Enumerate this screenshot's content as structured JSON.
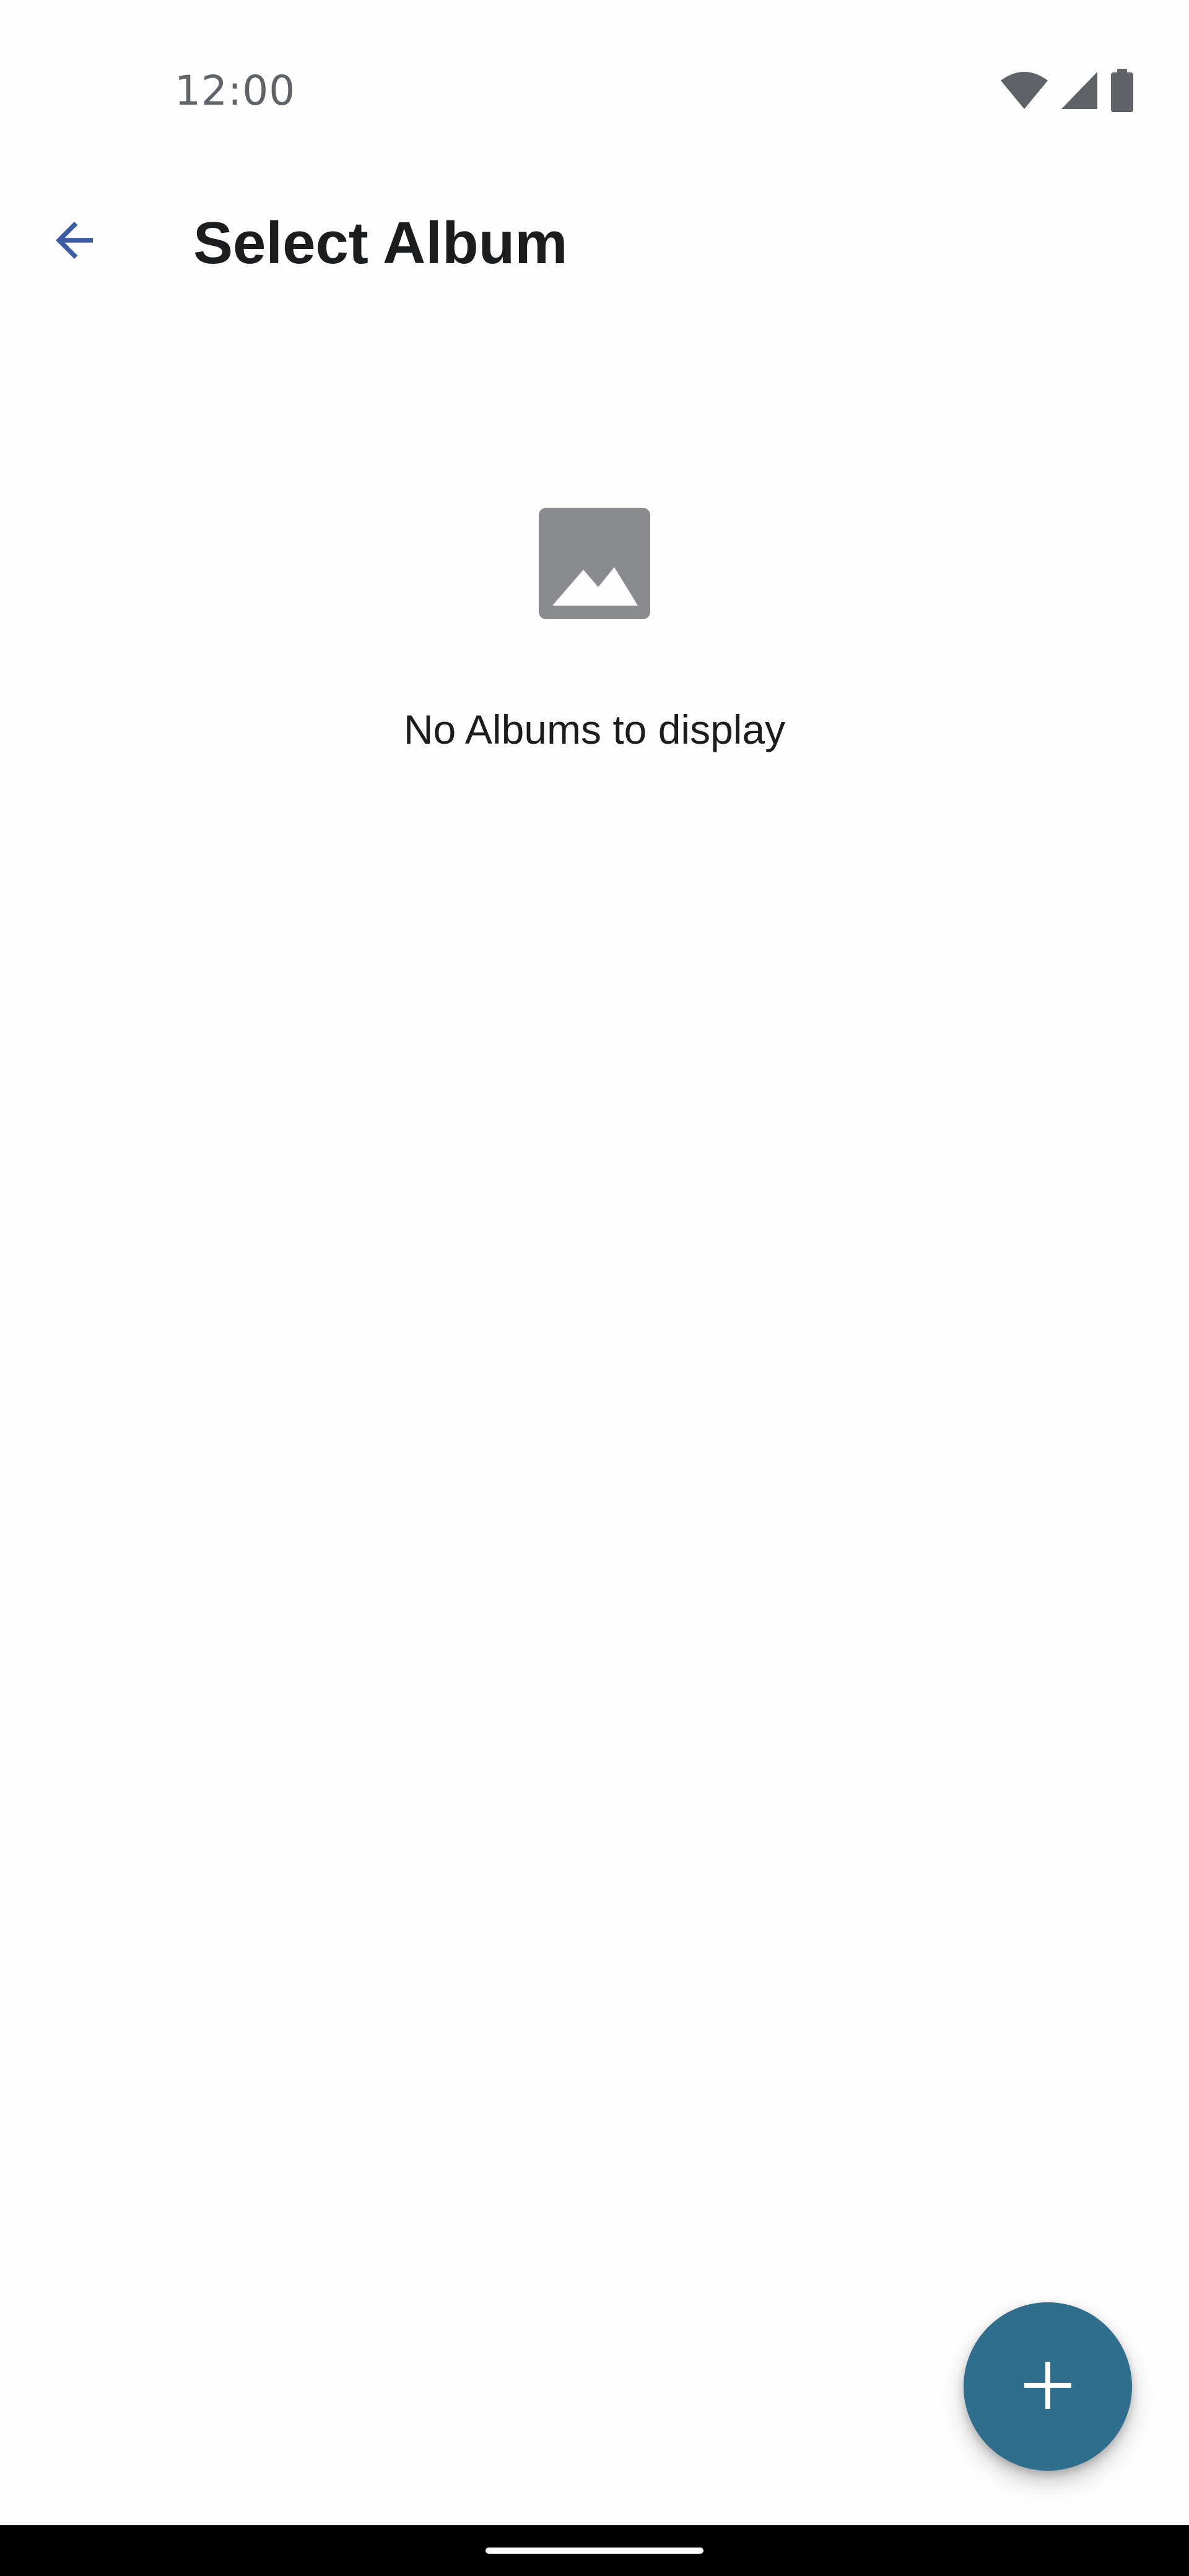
{
  "status_bar": {
    "time": "12:00",
    "icons": [
      "wifi-icon",
      "cellular-signal-icon",
      "battery-icon"
    ]
  },
  "app_bar": {
    "back_icon": "arrow-back-icon",
    "title": "Select Album"
  },
  "empty_state": {
    "icon": "image-placeholder-icon",
    "message": "No Albums to display"
  },
  "fab": {
    "icon": "plus-icon"
  },
  "colors": {
    "background": "#fefefe",
    "accent_back_arrow": "#3b5ba5",
    "fab": "#2f6e8c",
    "placeholder_icon": "#8a8b8e",
    "text": "#1b1c1e",
    "status_text": "#5f6368",
    "nav_bar": "#000000"
  }
}
